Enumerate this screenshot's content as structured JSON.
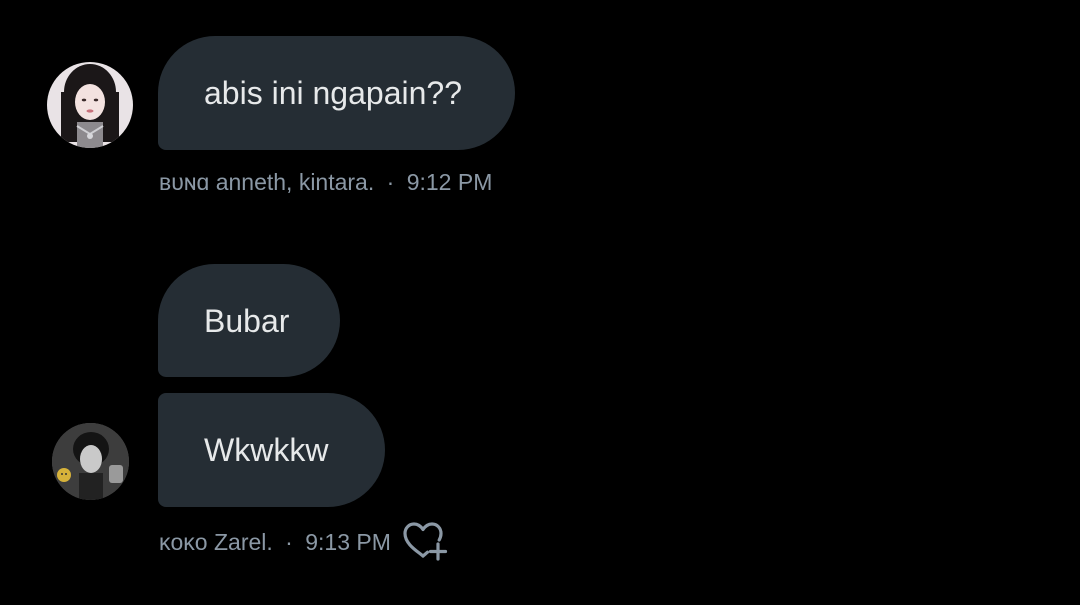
{
  "conversation": {
    "messages": [
      {
        "text": "abis ini ngapain??",
        "sender": "ʙᴜɴɑ anneth, kintara.",
        "time": "9:12 PM"
      },
      {
        "text": "Bubar"
      },
      {
        "text": "Wkwkkw",
        "sender": "ᴋᴏᴋᴏ Zarel.",
        "time": "9:13 PM",
        "reaction_icon": "heart-add-icon"
      }
    ],
    "separator": "·"
  },
  "colors": {
    "background": "#000000",
    "bubble": "#252d34",
    "text": "#e7e9ea",
    "meta": "#8b98a5"
  }
}
